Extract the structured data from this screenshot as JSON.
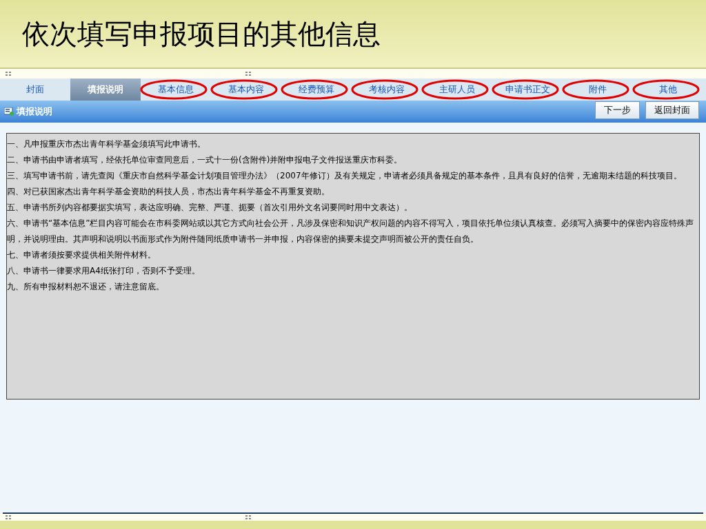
{
  "slide_title": "依次填写申报项目的其他信息",
  "tabs": [
    {
      "label": "封面",
      "selected": false,
      "circled": false
    },
    {
      "label": "填报说明",
      "selected": true,
      "circled": false
    },
    {
      "label": "基本信息",
      "selected": false,
      "circled": true
    },
    {
      "label": "基本内容",
      "selected": false,
      "circled": true
    },
    {
      "label": "经费预算",
      "selected": false,
      "circled": true
    },
    {
      "label": "考核内容",
      "selected": false,
      "circled": true
    },
    {
      "label": "主研人员",
      "selected": false,
      "circled": true
    },
    {
      "label": "申请书正文",
      "selected": false,
      "circled": true
    },
    {
      "label": "附件",
      "selected": false,
      "circled": true
    },
    {
      "label": "其他",
      "selected": false,
      "circled": true
    }
  ],
  "section": {
    "title": "填报说明",
    "buttons": [
      "下一步",
      "返回封面"
    ]
  },
  "instructions": [
    "一、凡申报重庆市杰出青年科学基金须填写此申请书。",
    "二、申请书由申请者填写，经依托单位审查同意后，一式十一份(含附件)并附申报电子文件报送重庆市科委。",
    "三、填写申请书前，请先查阅《重庆市自然科学基金计划项目管理办法》（2007年修订）及有关规定，申请者必须具备规定的基本条件，且具有良好的信誉，无逾期未结题的科技项目。",
    "四、对已获国家杰出青年科学基金资助的科技人员，市杰出青年科学基金不再重复资助。",
    "五、申请书所列内容都要据实填写，表达应明确、完整、严谨、扼要（首次引用外文名词要同时用中文表达）。",
    "六、申请书“基本信息”栏目内容可能会在市科委网站或以其它方式向社会公开，凡涉及保密和知识产权问题的内容不得写入，项目依托单位须认真核查。必须写入摘要中的保密内容应特殊声明，并说明理由。其声明和说明以书面形式作为附件随同纸质申请书一并申报，内容保密的摘要未提交声明而被公开的责任自负。",
    "七、申请者须按要求提供相关附件材料。",
    "八、申请书一律要求用A4纸张打印，否则不予受理。",
    "九、所有申报材料恕不退还，请注意留底。"
  ]
}
